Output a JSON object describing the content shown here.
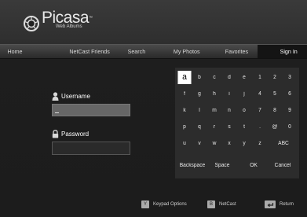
{
  "app": {
    "title": "Picasa",
    "trademark": "™",
    "subtitle": "Web Albums"
  },
  "nav": {
    "items": [
      "Home",
      "NetCast Friends",
      "Search",
      "My Photos",
      "Favorites",
      "Sign In"
    ],
    "active": "Sign In"
  },
  "form": {
    "username_label": "Username",
    "username_value": "",
    "password_label": "Password",
    "password_value": ""
  },
  "keyboard": {
    "rows": [
      [
        "a",
        "b",
        "c",
        "d",
        "e",
        "1",
        "2",
        "3"
      ],
      [
        "f",
        "g",
        "h",
        "i",
        "j",
        "4",
        "5",
        "6"
      ],
      [
        "k",
        "l",
        "m",
        "n",
        "o",
        "7",
        "8",
        "9"
      ],
      [
        "p",
        "q",
        "r",
        "s",
        "t",
        ".",
        "@",
        "0"
      ],
      [
        "u",
        "v",
        "w",
        "x",
        "y",
        "z",
        "ABC"
      ],
      [
        "Backspace",
        "Space",
        "OK",
        "Cancel"
      ]
    ],
    "selected": "a"
  },
  "hints": [
    {
      "button": "Y",
      "label": "Keypad Options",
      "color": "#a8a8a8"
    },
    {
      "button": "B",
      "label": "NetCast",
      "color": "#a8a8a8"
    },
    {
      "button": "return-icon",
      "label": "Return",
      "color": "#a8a8a8"
    }
  ],
  "colors": {
    "background": "#1c1c1c",
    "keyboard_bg": "#2c2c2c",
    "selected_key": "#ffffff",
    "active_field": "#666666"
  }
}
